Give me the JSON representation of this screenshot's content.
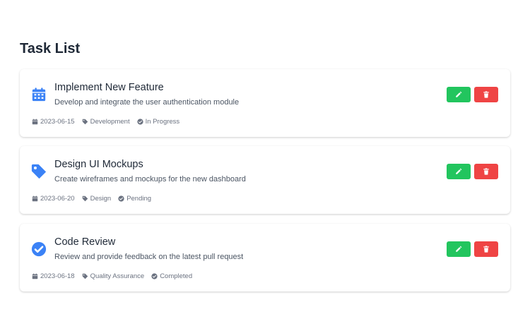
{
  "page": {
    "title": "Task List"
  },
  "colors": {
    "accent_blue": "#3b82f6",
    "edit_green": "#22c55e",
    "delete_red": "#ef4444",
    "meta_gray": "#6b7280"
  },
  "tasks": [
    {
      "icon": "calendar-icon",
      "title": "Implement New Feature",
      "description": "Develop and integrate the user authentication module",
      "date": "2023-06-15",
      "category": "Development",
      "status": "In Progress",
      "edit_icon": "edit-icon",
      "delete_icon": "trash-icon"
    },
    {
      "icon": "tag-icon",
      "title": "Design UI Mockups",
      "description": "Create wireframes and mockups for the new dashboard",
      "date": "2023-06-20",
      "category": "Design",
      "status": "Pending",
      "edit_icon": "edit-icon",
      "delete_icon": "trash-icon"
    },
    {
      "icon": "check-circle-icon",
      "title": "Code Review",
      "description": "Review and provide feedback on the latest pull request",
      "date": "2023-06-18",
      "category": "Quality Assurance",
      "status": "Completed",
      "edit_icon": "edit-icon",
      "delete_icon": "trash-icon"
    }
  ]
}
